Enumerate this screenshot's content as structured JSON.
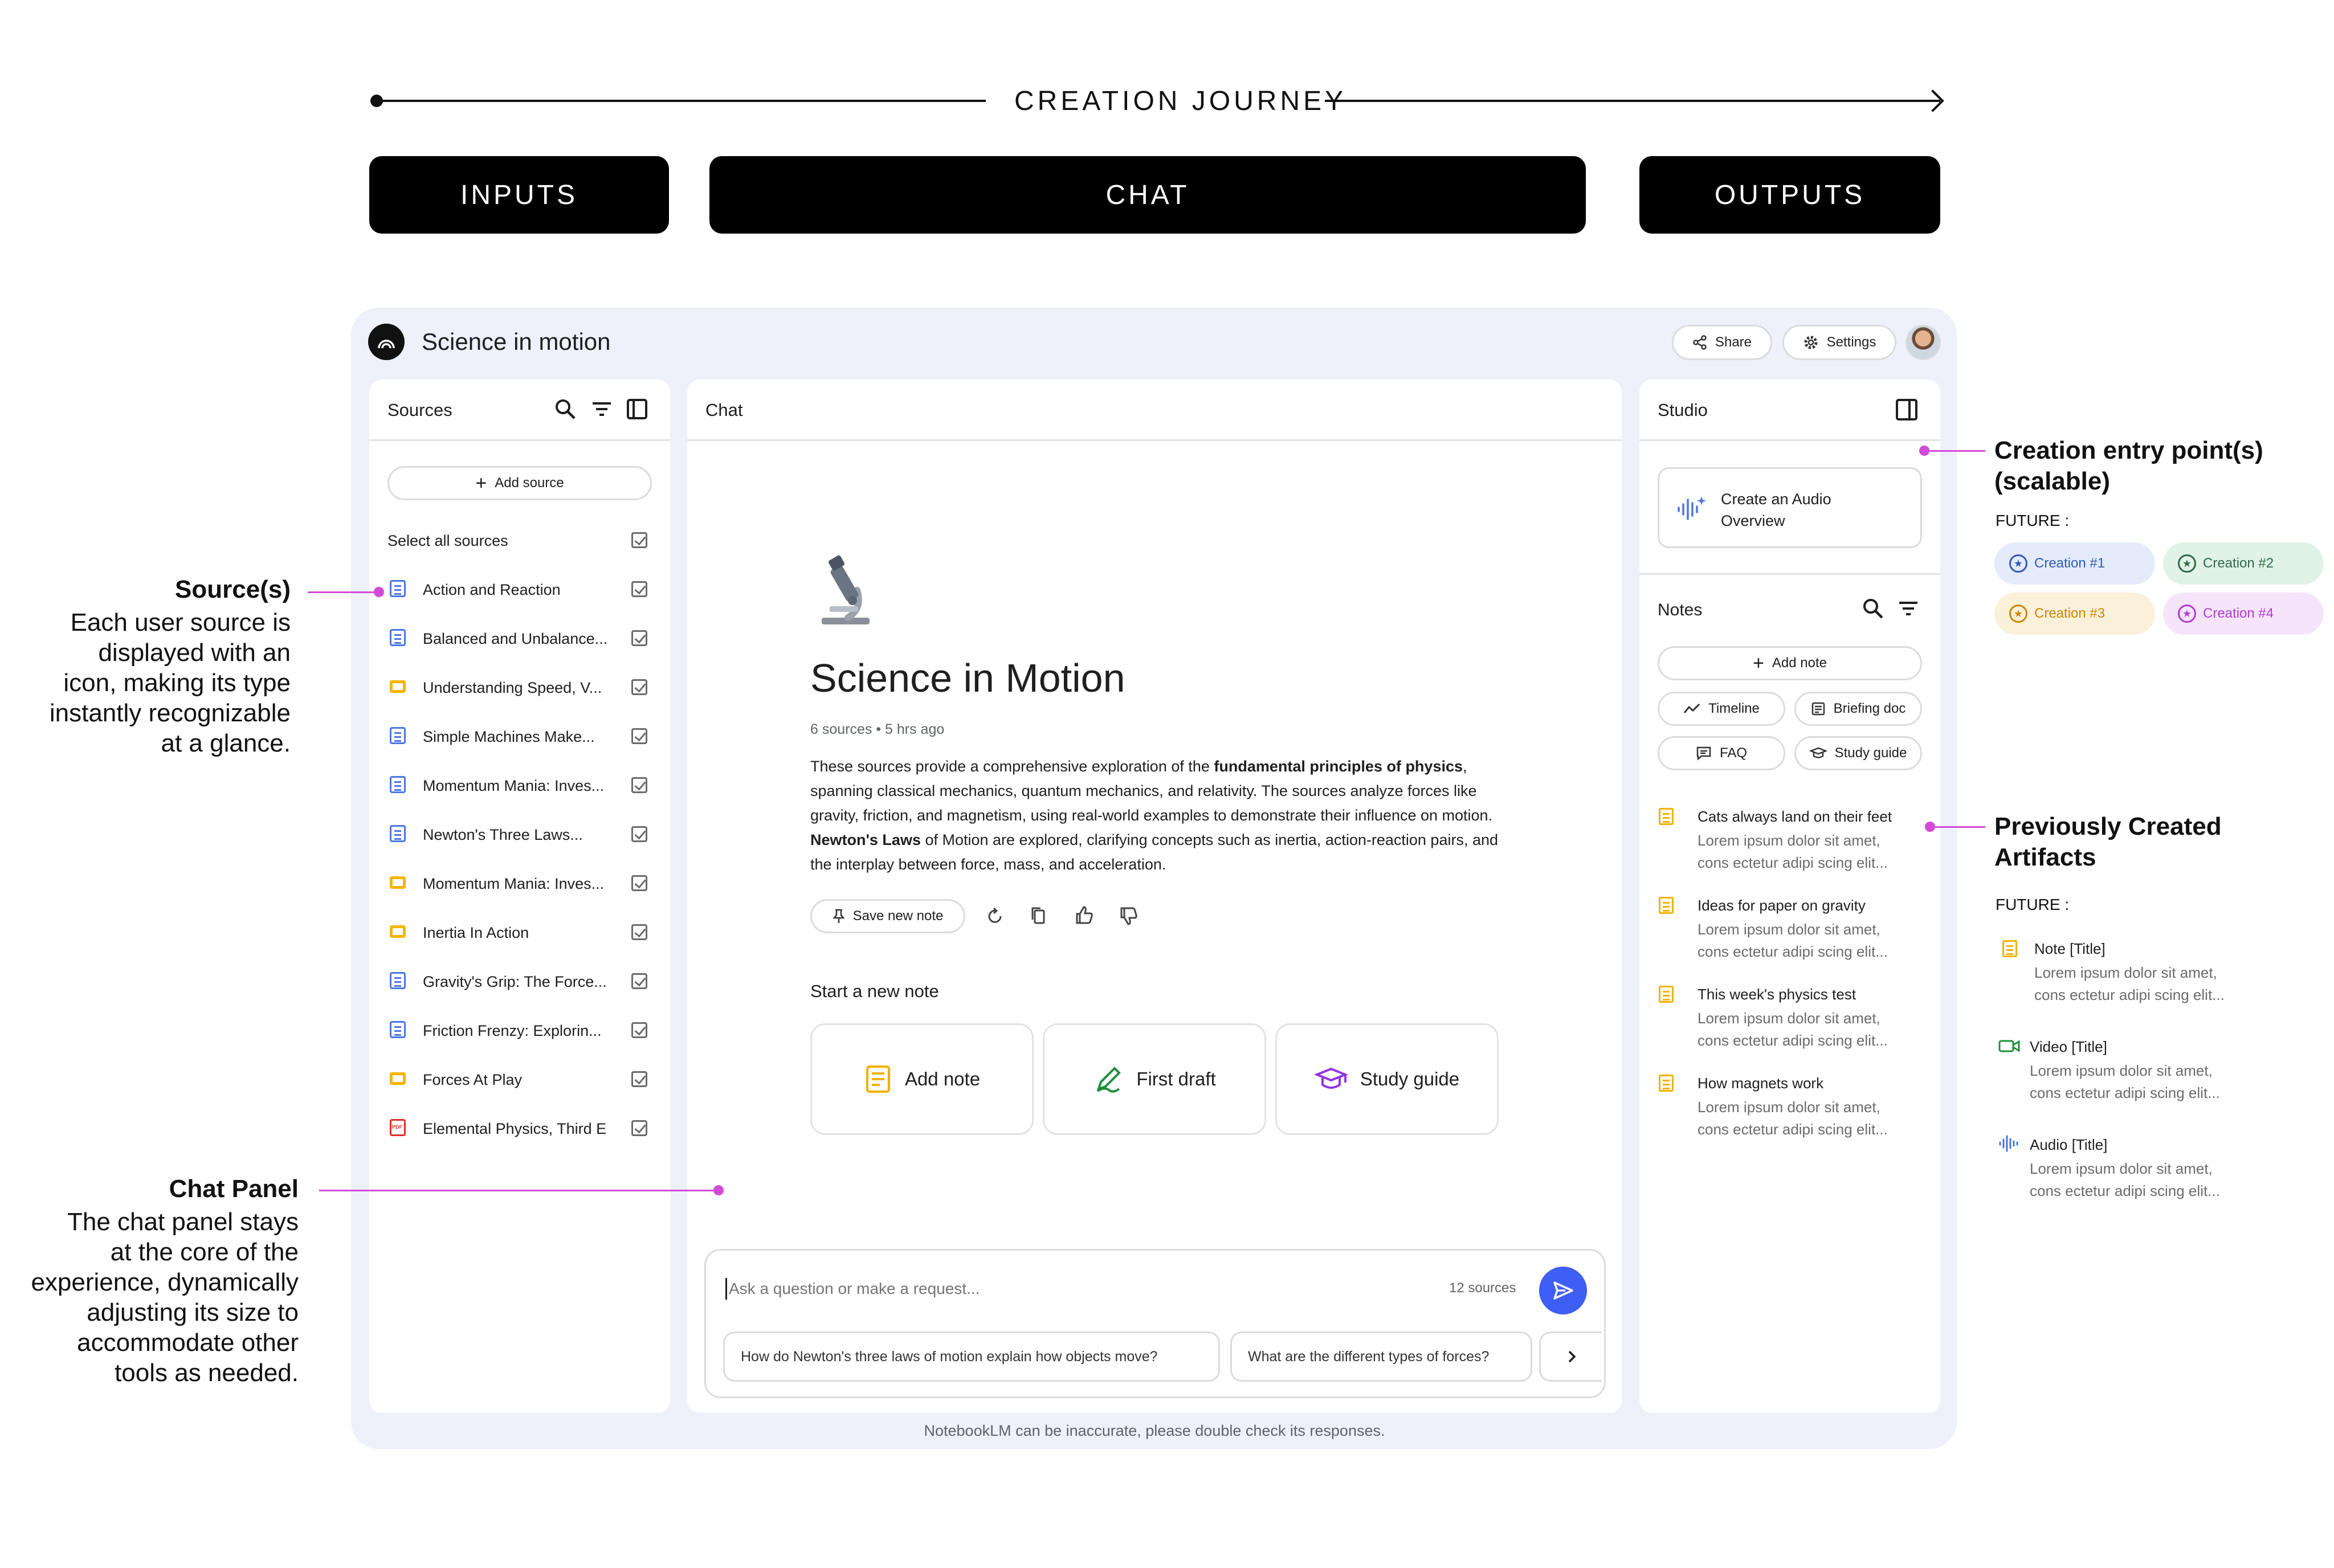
{
  "journey": {
    "title": "CREATION JOURNEY",
    "phases": [
      "INPUTS",
      "CHAT",
      "OUTPUTS"
    ]
  },
  "app": {
    "notebook_title": "Science in motion",
    "share_label": "Share",
    "settings_label": "Settings",
    "disclaimer": "NotebookLM can be inaccurate, please double check its responses."
  },
  "sources": {
    "title": "Sources",
    "add_label": "Add source",
    "select_all": "Select all sources",
    "items": [
      {
        "label": "Action and Reaction",
        "type": "doc"
      },
      {
        "label": "Balanced and Unbalance...",
        "type": "doc"
      },
      {
        "label": "Understanding Speed, V...",
        "type": "slides"
      },
      {
        "label": "Simple Machines Make...",
        "type": "doc"
      },
      {
        "label": "Momentum Mania: Inves...",
        "type": "doc"
      },
      {
        "label": "Newton's Three Laws...",
        "type": "doc"
      },
      {
        "label": "Momentum Mania: Inves...",
        "type": "slides"
      },
      {
        "label": "Inertia In Action",
        "type": "slides"
      },
      {
        "label": "Gravity's Grip: The Force...",
        "type": "doc"
      },
      {
        "label": "Friction Frenzy: Explorin...",
        "type": "doc"
      },
      {
        "label": "Forces At Play",
        "type": "slides"
      },
      {
        "label": "Elemental Physics, Third E",
        "type": "pdf"
      }
    ]
  },
  "chat": {
    "title": "Chat",
    "notebook_heading": "Science in Motion",
    "meta": "6 sources • 5 hrs ago",
    "summary_parts": [
      "These sources provide a comprehensive exploration of the ",
      "fundamental principles of physics",
      ", spanning classical mechanics, quantum mechanics, and relativity. The sources analyze forces like gravity, friction, and magnetism, using real-world examples to demonstrate their influence on motion. ",
      "Newton's Laws",
      " of Motion are explored, clarifying concepts such as inertia, action-reaction pairs, and the interplay between force, mass, and acceleration."
    ],
    "save_note": "Save new note",
    "start_note": "Start a new note",
    "cards": [
      "Add note",
      "First draft",
      "Study guide"
    ],
    "input_placeholder": "Ask a question or make a request...",
    "source_count": "12 sources",
    "suggestions": [
      "How do Newton's three laws of motion explain how objects move?",
      "What are the different types of forces?"
    ]
  },
  "studio": {
    "title": "Studio",
    "audio_overview": "Create an Audio Overview",
    "notes_title": "Notes",
    "add_note": "Add note",
    "actions": [
      "Timeline",
      "Briefing doc",
      "FAQ",
      "Study guide"
    ],
    "notes": [
      {
        "title": "Cats always land on their feet",
        "line1": "Lorem ipsum dolor sit amet,",
        "line2": "cons ectetur adipi scing elit..."
      },
      {
        "title": "Ideas for paper on gravity",
        "line1": "Lorem ipsum dolor sit amet,",
        "line2": "cons ectetur adipi scing elit..."
      },
      {
        "title": "This week's physics test",
        "line1": "Lorem ipsum dolor sit amet,",
        "line2": "cons ectetur adipi scing elit..."
      },
      {
        "title": "How magnets work",
        "line1": "Lorem ipsum dolor sit amet,",
        "line2": "cons ectetur adipi scing elit..."
      }
    ]
  },
  "annotations": {
    "sources_title": "Source(s)",
    "sources_body": [
      "Each user source is",
      "displayed with an",
      "icon, making its type",
      "instantly recognizable",
      "at a glance."
    ],
    "chat_title": "Chat Panel",
    "chat_body": [
      "The chat panel stays",
      "at the core of the",
      "experience, dynamically",
      "adjusting its size to",
      "accommodate other",
      "tools as needed."
    ],
    "entry_title": [
      "Creation entry point(s)",
      "(scalable)"
    ],
    "future_label": "FUTURE :",
    "creations": [
      {
        "label": "Creation #1",
        "color": "#2f5bb7",
        "bg": "#e4ebfb"
      },
      {
        "label": "Creation #2",
        "color": "#2e6b48",
        "bg": "#e1f2e6"
      },
      {
        "label": "Creation #3",
        "color": "#c98a00",
        "bg": "#fbf0d9"
      },
      {
        "label": "Creation #4",
        "color": "#b23ed1",
        "bg": "#f6e4fb"
      }
    ],
    "artifacts_title": [
      "Previously Created",
      "Artifacts"
    ],
    "future_label2": "FUTURE :",
    "artifacts": [
      {
        "title": "Note [Title]",
        "line1": "Lorem ipsum dolor sit amet,",
        "line2": "cons ectetur adipi scing elit...",
        "icon": "note-icon"
      },
      {
        "title": "Video [Title]",
        "line1": "Lorem ipsum dolor sit amet,",
        "line2": "cons ectetur adipi scing elit...",
        "icon": "video-icon"
      },
      {
        "title": "Audio [Title]",
        "line1": "Lorem ipsum dolor sit amet,",
        "line2": "cons ectetur adipi scing elit...",
        "icon": "audio-icon"
      }
    ]
  }
}
